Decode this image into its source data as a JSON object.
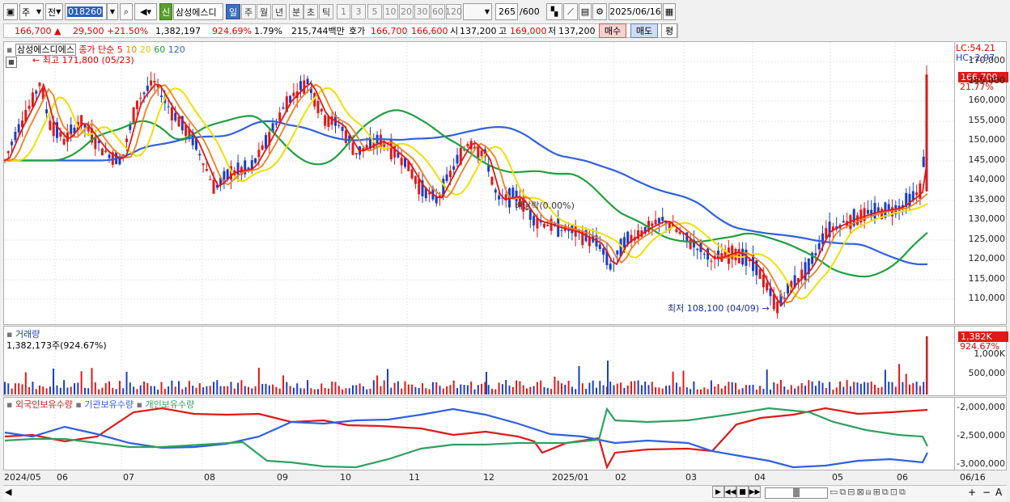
{
  "toolbar": {
    "period_type": "주",
    "compare_label": "전",
    "stock_code": "018260",
    "new_badge": "신",
    "stock_name": "삼성에스디",
    "period_buttons": [
      "일",
      "주",
      "월",
      "년",
      "분",
      "초",
      "틱"
    ],
    "selected_period": "일",
    "interval_buttons": [
      "1",
      "3",
      "5",
      "10",
      "20",
      "30",
      "60",
      "120"
    ],
    "bar_count": "265",
    "bar_max": "/600",
    "date": "2025/06/16"
  },
  "quote": {
    "price": "166,700",
    "change_arrow": "▲",
    "change": "29,500",
    "change_pct": "+21.50%",
    "volume": "1,382,197",
    "volume_ratio": "924.69%",
    "turnover": "1.79%",
    "amount": "215,744백만",
    "bid_label": "호가",
    "ask": "166,700",
    "bid": "166,600",
    "open_label": "시",
    "open": "137,200",
    "high_label": "고",
    "high": "169,000",
    "low_label": "저",
    "low": "137,200",
    "buy_btn": "매수",
    "sell_btn": "매도",
    "eval_btn": "평"
  },
  "price_panel": {
    "stock_label": "삼성에스디에스",
    "ma_title": "종가 단순",
    "ma_periods": [
      "5",
      "10",
      "20",
      "60",
      "120"
    ],
    "high_note": "최고 171,800 (05/23)",
    "low_note": "최저 108,100 (04/09)",
    "dividend_note": "배당락(0.00%)",
    "lc": "LC:54.21",
    "hc": "HC:-2.97",
    "price_tag": "166,700",
    "pct_tag": "21.77%",
    "y_ticks": [
      "170,000",
      "165,000",
      "160,000",
      "155,000",
      "150,000",
      "145,000",
      "140,000",
      "135,000",
      "130,000",
      "125,000",
      "120,000",
      "115,000",
      "110,000"
    ]
  },
  "volume_panel": {
    "title": "거래량",
    "value": "1,382,173주(924.67%)",
    "tag": "1,382K",
    "pct_tag": "924.67%",
    "y_ticks": [
      "1,000K",
      "500,000"
    ]
  },
  "holding_panel": {
    "legends": [
      "외국인보유수량",
      "기관보유수량",
      "개인보유수량"
    ],
    "y_ticks": [
      "-2,000,000",
      "-2,500,000",
      "-3,000,000"
    ]
  },
  "x_axis": [
    "2024/05",
    "06",
    "07",
    "08",
    "09",
    "10",
    "11",
    "12",
    "2025/01",
    "02",
    "03",
    "04",
    "05",
    "06",
    "06/16"
  ],
  "colors": {
    "up": "#e01818",
    "down": "#1a3ec8",
    "ma5": "#e01818",
    "ma10": "#f08020",
    "ma20": "#f0e000",
    "ma60": "#20a040",
    "ma120": "#3060e0",
    "foreign": "#e01818",
    "inst": "#3060e0",
    "indiv": "#30a060"
  }
}
